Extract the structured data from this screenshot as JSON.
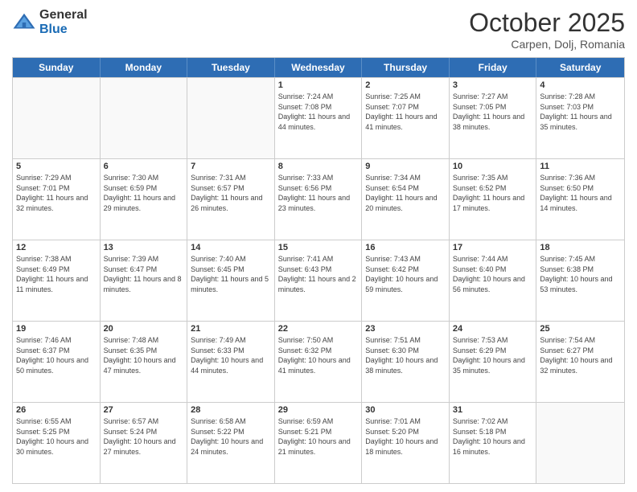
{
  "header": {
    "logo_general": "General",
    "logo_blue": "Blue",
    "month": "October 2025",
    "location": "Carpen, Dolj, Romania"
  },
  "days_of_week": [
    "Sunday",
    "Monday",
    "Tuesday",
    "Wednesday",
    "Thursday",
    "Friday",
    "Saturday"
  ],
  "weeks": [
    [
      {
        "day": "",
        "sunrise": "",
        "sunset": "",
        "daylight": "",
        "empty": true
      },
      {
        "day": "",
        "sunrise": "",
        "sunset": "",
        "daylight": "",
        "empty": true
      },
      {
        "day": "",
        "sunrise": "",
        "sunset": "",
        "daylight": "",
        "empty": true
      },
      {
        "day": "1",
        "sunrise": "Sunrise: 7:24 AM",
        "sunset": "Sunset: 7:08 PM",
        "daylight": "Daylight: 11 hours and 44 minutes."
      },
      {
        "day": "2",
        "sunrise": "Sunrise: 7:25 AM",
        "sunset": "Sunset: 7:07 PM",
        "daylight": "Daylight: 11 hours and 41 minutes."
      },
      {
        "day": "3",
        "sunrise": "Sunrise: 7:27 AM",
        "sunset": "Sunset: 7:05 PM",
        "daylight": "Daylight: 11 hours and 38 minutes."
      },
      {
        "day": "4",
        "sunrise": "Sunrise: 7:28 AM",
        "sunset": "Sunset: 7:03 PM",
        "daylight": "Daylight: 11 hours and 35 minutes."
      }
    ],
    [
      {
        "day": "5",
        "sunrise": "Sunrise: 7:29 AM",
        "sunset": "Sunset: 7:01 PM",
        "daylight": "Daylight: 11 hours and 32 minutes."
      },
      {
        "day": "6",
        "sunrise": "Sunrise: 7:30 AM",
        "sunset": "Sunset: 6:59 PM",
        "daylight": "Daylight: 11 hours and 29 minutes."
      },
      {
        "day": "7",
        "sunrise": "Sunrise: 7:31 AM",
        "sunset": "Sunset: 6:57 PM",
        "daylight": "Daylight: 11 hours and 26 minutes."
      },
      {
        "day": "8",
        "sunrise": "Sunrise: 7:33 AM",
        "sunset": "Sunset: 6:56 PM",
        "daylight": "Daylight: 11 hours and 23 minutes."
      },
      {
        "day": "9",
        "sunrise": "Sunrise: 7:34 AM",
        "sunset": "Sunset: 6:54 PM",
        "daylight": "Daylight: 11 hours and 20 minutes."
      },
      {
        "day": "10",
        "sunrise": "Sunrise: 7:35 AM",
        "sunset": "Sunset: 6:52 PM",
        "daylight": "Daylight: 11 hours and 17 minutes."
      },
      {
        "day": "11",
        "sunrise": "Sunrise: 7:36 AM",
        "sunset": "Sunset: 6:50 PM",
        "daylight": "Daylight: 11 hours and 14 minutes."
      }
    ],
    [
      {
        "day": "12",
        "sunrise": "Sunrise: 7:38 AM",
        "sunset": "Sunset: 6:49 PM",
        "daylight": "Daylight: 11 hours and 11 minutes."
      },
      {
        "day": "13",
        "sunrise": "Sunrise: 7:39 AM",
        "sunset": "Sunset: 6:47 PM",
        "daylight": "Daylight: 11 hours and 8 minutes."
      },
      {
        "day": "14",
        "sunrise": "Sunrise: 7:40 AM",
        "sunset": "Sunset: 6:45 PM",
        "daylight": "Daylight: 11 hours and 5 minutes."
      },
      {
        "day": "15",
        "sunrise": "Sunrise: 7:41 AM",
        "sunset": "Sunset: 6:43 PM",
        "daylight": "Daylight: 11 hours and 2 minutes."
      },
      {
        "day": "16",
        "sunrise": "Sunrise: 7:43 AM",
        "sunset": "Sunset: 6:42 PM",
        "daylight": "Daylight: 10 hours and 59 minutes."
      },
      {
        "day": "17",
        "sunrise": "Sunrise: 7:44 AM",
        "sunset": "Sunset: 6:40 PM",
        "daylight": "Daylight: 10 hours and 56 minutes."
      },
      {
        "day": "18",
        "sunrise": "Sunrise: 7:45 AM",
        "sunset": "Sunset: 6:38 PM",
        "daylight": "Daylight: 10 hours and 53 minutes."
      }
    ],
    [
      {
        "day": "19",
        "sunrise": "Sunrise: 7:46 AM",
        "sunset": "Sunset: 6:37 PM",
        "daylight": "Daylight: 10 hours and 50 minutes."
      },
      {
        "day": "20",
        "sunrise": "Sunrise: 7:48 AM",
        "sunset": "Sunset: 6:35 PM",
        "daylight": "Daylight: 10 hours and 47 minutes."
      },
      {
        "day": "21",
        "sunrise": "Sunrise: 7:49 AM",
        "sunset": "Sunset: 6:33 PM",
        "daylight": "Daylight: 10 hours and 44 minutes."
      },
      {
        "day": "22",
        "sunrise": "Sunrise: 7:50 AM",
        "sunset": "Sunset: 6:32 PM",
        "daylight": "Daylight: 10 hours and 41 minutes."
      },
      {
        "day": "23",
        "sunrise": "Sunrise: 7:51 AM",
        "sunset": "Sunset: 6:30 PM",
        "daylight": "Daylight: 10 hours and 38 minutes."
      },
      {
        "day": "24",
        "sunrise": "Sunrise: 7:53 AM",
        "sunset": "Sunset: 6:29 PM",
        "daylight": "Daylight: 10 hours and 35 minutes."
      },
      {
        "day": "25",
        "sunrise": "Sunrise: 7:54 AM",
        "sunset": "Sunset: 6:27 PM",
        "daylight": "Daylight: 10 hours and 32 minutes."
      }
    ],
    [
      {
        "day": "26",
        "sunrise": "Sunrise: 6:55 AM",
        "sunset": "Sunset: 5:25 PM",
        "daylight": "Daylight: 10 hours and 30 minutes."
      },
      {
        "day": "27",
        "sunrise": "Sunrise: 6:57 AM",
        "sunset": "Sunset: 5:24 PM",
        "daylight": "Daylight: 10 hours and 27 minutes."
      },
      {
        "day": "28",
        "sunrise": "Sunrise: 6:58 AM",
        "sunset": "Sunset: 5:22 PM",
        "daylight": "Daylight: 10 hours and 24 minutes."
      },
      {
        "day": "29",
        "sunrise": "Sunrise: 6:59 AM",
        "sunset": "Sunset: 5:21 PM",
        "daylight": "Daylight: 10 hours and 21 minutes."
      },
      {
        "day": "30",
        "sunrise": "Sunrise: 7:01 AM",
        "sunset": "Sunset: 5:20 PM",
        "daylight": "Daylight: 10 hours and 18 minutes."
      },
      {
        "day": "31",
        "sunrise": "Sunrise: 7:02 AM",
        "sunset": "Sunset: 5:18 PM",
        "daylight": "Daylight: 10 hours and 16 minutes."
      },
      {
        "day": "",
        "sunrise": "",
        "sunset": "",
        "daylight": "",
        "empty": true
      }
    ]
  ]
}
